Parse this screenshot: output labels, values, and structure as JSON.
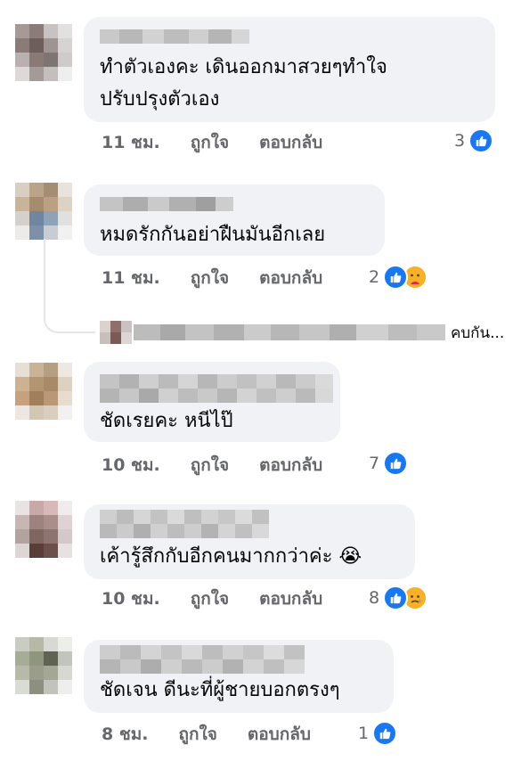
{
  "comments": [
    {
      "text_lines": [
        "ทำตัวเองคะ เดินออกมาสวยๆทำใจ",
        "ปรับปรุงตัวเอง"
      ],
      "time": "11 ชม.",
      "like_label": "ถูกใจ",
      "reply_label": "ตอบกลับ",
      "reaction_count": "3",
      "reactions": [
        "like-icon"
      ]
    },
    {
      "text_lines": [
        "หมดรักกันอย่าฝืนมันอีกเลย"
      ],
      "time": "11 ชม.",
      "like_label": "ถูกใจ",
      "reply_label": "ตอบกลับ",
      "reaction_count": "2",
      "reactions": [
        "like-icon",
        "care-icon"
      ]
    },
    {
      "text_lines": [
        "ชัดเรยคะ หนีไป๊"
      ],
      "time": "10 ชม.",
      "like_label": "ถูกใจ",
      "reply_label": "ตอบกลับ",
      "reaction_count": "7",
      "reactions": [
        "like-icon"
      ]
    },
    {
      "text_lines": [
        "เค้ารู้สึกกับอีกคนมากกว่าค่ะ 😭"
      ],
      "time": "10 ชม.",
      "like_label": "ถูกใจ",
      "reply_label": "ตอบกลับ",
      "reaction_count": "8",
      "reactions": [
        "like-icon",
        "sad-icon"
      ]
    },
    {
      "text_lines": [
        "ชัดเจน ดีนะที่ผู้ชายบอกตรงๆ"
      ],
      "time": "8 ชม.",
      "like_label": "ถูกใจ",
      "reply_label": "ตอบกลับ",
      "reaction_count": "1",
      "reactions": [
        "like-icon"
      ]
    }
  ],
  "reply_preview": {
    "text": "คบกัน..."
  },
  "colors": {
    "bubble": "#f0f2f5",
    "meta_text": "#65676b",
    "like_blue": "#1877f2",
    "emoji_yellow": "#f7b125"
  }
}
